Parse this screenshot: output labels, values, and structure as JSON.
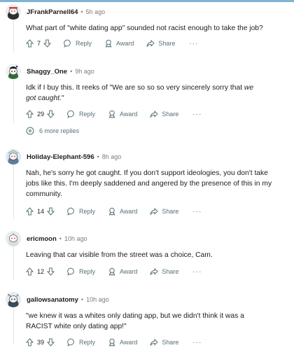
{
  "comments": [
    {
      "username": "JFrankParnell64",
      "time": "5h ago",
      "body": "What part of \"white dating app\" sounded not racist enough to take the job?",
      "votes": "7",
      "reply_label": "Reply",
      "award_label": "Award",
      "share_label": "Share",
      "more_label": "···"
    },
    {
      "username": "Shaggy_One",
      "time": "9h ago",
      "body_plain": "Idk if I buy this. It reeks of \"We are so so so very sincerely sorry that ",
      "body_emph": "we got caught.",
      "body_end": "\"",
      "votes": "29",
      "reply_label": "Reply",
      "award_label": "Award",
      "share_label": "Share",
      "more_label": "···",
      "more_replies": "6 more replies"
    },
    {
      "username": "Holiday-Elephant-596",
      "time": "8h ago",
      "body": "Nah, he's sorry he got caught. If you don't support ideologies, you don't take jobs like this. I'm deeply saddened and angered by the presence of this in my community.",
      "votes": "14",
      "reply_label": "Reply",
      "award_label": "Award",
      "share_label": "Share",
      "more_label": "···"
    },
    {
      "username": "ericmoon",
      "time": "10h ago",
      "body": "Leaving that car visible from the street was a choice, Cam.",
      "votes": "12",
      "reply_label": "Reply",
      "award_label": "Award",
      "share_label": "Share",
      "more_label": "···"
    },
    {
      "username": "gallowsanatomy",
      "time": "10h ago",
      "body": "\"we knew it was a whites only dating app, but we didn't think it was a RACIST white only dating app!\"",
      "votes": "39",
      "reply_label": "Reply",
      "award_label": "Award",
      "share_label": "Share",
      "more_label": "···"
    }
  ],
  "separator": "•",
  "colors": {
    "text": "#1c1c1c",
    "meta": "#7c7c7c",
    "action": "#576f76",
    "thread_line": "#e3e5e8"
  }
}
